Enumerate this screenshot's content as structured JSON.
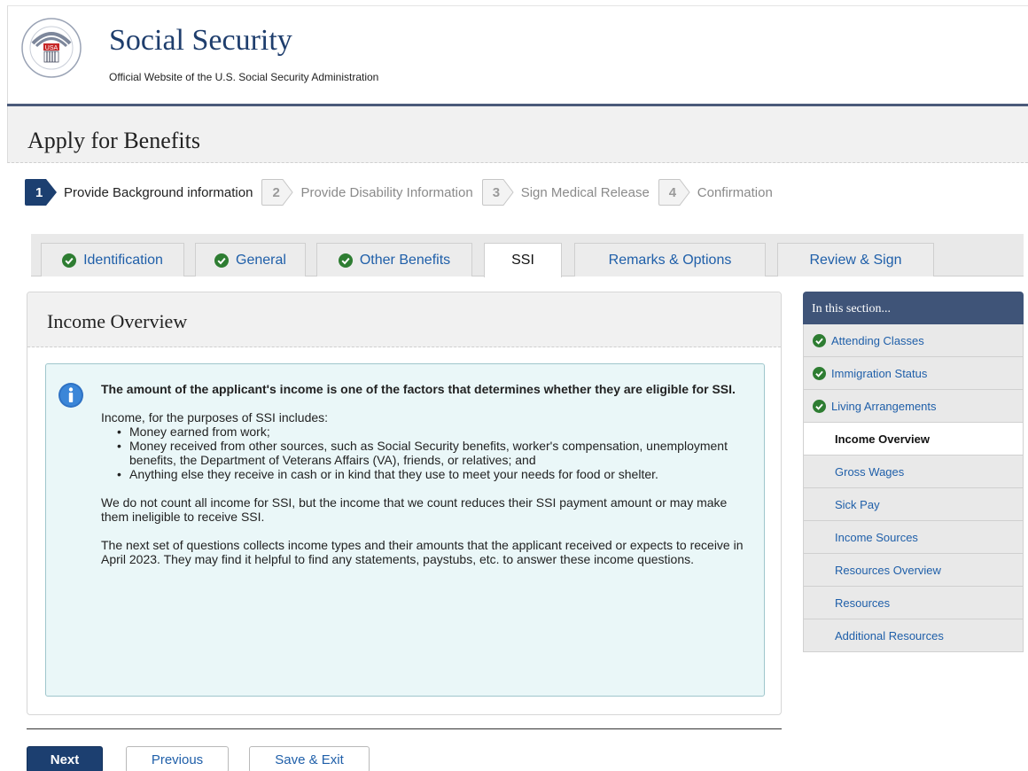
{
  "header": {
    "title": "Social Security",
    "subtitle": "Official Website of the U.S. Social Security Administration",
    "logo_icon": "ssa-seal-icon"
  },
  "page": {
    "title": "Apply for Benefits"
  },
  "steps": [
    {
      "number": "1",
      "label": "Provide Background information",
      "active": true
    },
    {
      "number": "2",
      "label": "Provide Disability Information",
      "active": false
    },
    {
      "number": "3",
      "label": "Sign Medical Release",
      "active": false
    },
    {
      "number": "4",
      "label": "Confirmation",
      "active": false
    }
  ],
  "tabs": [
    {
      "label": "Identification",
      "complete": true
    },
    {
      "label": "General",
      "complete": true
    },
    {
      "label": "Other Benefits",
      "complete": true
    },
    {
      "label": "SSI",
      "complete": false,
      "active": true
    },
    {
      "label": "Remarks & Options",
      "complete": false
    },
    {
      "label": "Review & Sign",
      "complete": false
    }
  ],
  "panel": {
    "title": "Income Overview",
    "info": {
      "lead": "The amount of the applicant's income is one of the factors that determines whether they are eligible for SSI.",
      "intro": "Income, for the purposes of SSI includes:",
      "items": [
        "Money earned from work;",
        "Money received from other sources, such as Social Security benefits, worker's compensation, unemployment benefits, the Department of Veterans Affairs (VA), friends, or relatives; and",
        "Anything else they receive in cash or in kind that they use to meet your needs for food or shelter."
      ],
      "para1": "We do not count all income for SSI, but the income that we count reduces their SSI payment amount or may make them ineligible to receive SSI.",
      "para2": "The next set of questions collects income types and their amounts that the applicant received or expects to receive in April 2023. They may find it helpful to find any statements, paystubs, etc. to answer these income questions."
    }
  },
  "buttons": {
    "next": "Next",
    "previous": "Previous",
    "save_exit": "Save & Exit"
  },
  "sidebar": {
    "heading": "In this section...",
    "items": [
      {
        "label": "Attending Classes",
        "status": "done"
      },
      {
        "label": "Immigration Status",
        "status": "done"
      },
      {
        "label": "Living Arrangements",
        "status": "done"
      },
      {
        "label": "Income Overview",
        "status": "current"
      },
      {
        "label": "Gross Wages",
        "status": "pending"
      },
      {
        "label": "Sick Pay",
        "status": "pending"
      },
      {
        "label": "Income Sources",
        "status": "pending"
      },
      {
        "label": "Resources Overview",
        "status": "pending"
      },
      {
        "label": "Resources",
        "status": "pending"
      },
      {
        "label": "Additional Resources",
        "status": "pending"
      }
    ]
  },
  "colors": {
    "brand_navy": "#1c3f70",
    "link_blue": "#1f5fa9",
    "check_green": "#2e7d32",
    "info_bg": "#eaf7f8"
  }
}
